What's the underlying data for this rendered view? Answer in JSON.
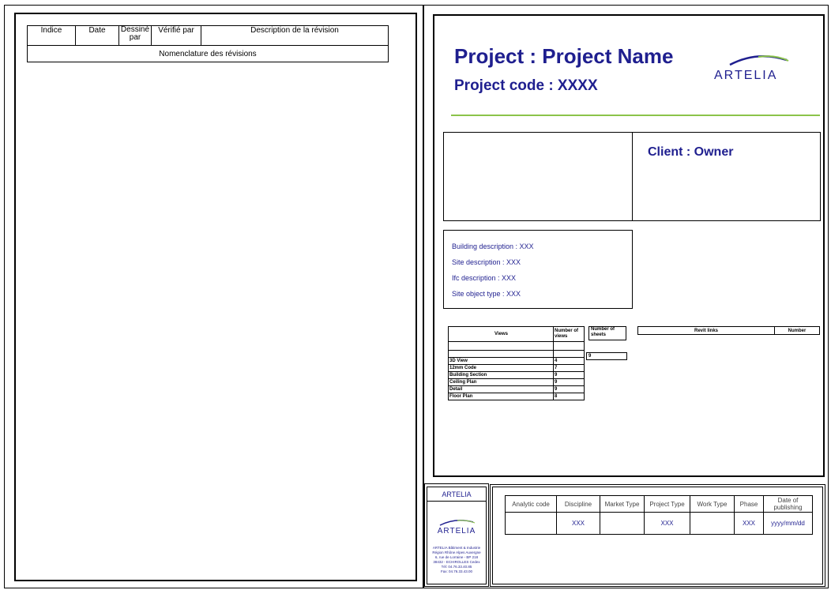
{
  "revision_table": {
    "headers": [
      "Indice",
      "Date",
      "Dessiné par",
      "Vérifié par",
      "Description de la révision"
    ],
    "nomenclature_label": "Nomenclature des révisions"
  },
  "project": {
    "name_line": "Project : Project Name",
    "code_line": "Project code : XXXX",
    "logo_text": "ARTELIA"
  },
  "colors": {
    "title_blue": "#1f1f8f",
    "accent_green": "#8bc34a"
  },
  "client": {
    "label": "Client : Owner"
  },
  "info_lines": [
    "Building description : XXX",
    "Site description : XXX",
    "Ifc description : XXX",
    "Site object type : XXX"
  ],
  "views_table": {
    "headers": [
      "Views",
      "Number of views",
      "Number of sheets"
    ],
    "rows": [
      {
        "name": "3D View",
        "count": "4"
      },
      {
        "name": "12mm Code",
        "count": "7"
      },
      {
        "name": "Building Section",
        "count": "9"
      },
      {
        "name": "Ceiling Plan",
        "count": "9"
      },
      {
        "name": "Detail",
        "count": "9"
      },
      {
        "name": "Floor Plan",
        "count": "8"
      }
    ],
    "sheets_value": "9"
  },
  "link_table": {
    "headers": [
      "Revit links",
      "Number"
    ]
  },
  "company_box": {
    "title": "ARTELIA",
    "logo_text": "ARTELIA",
    "address_lines": [
      "ARTELIA Bâtiment & Industrie",
      "Région Rhône Alpes Auvergne",
      "6, rue de Lorraine - BP 218",
      "38432 - ECHIROLLES Cedex",
      "Tél: 04.76.33.40.85",
      "Fax: 04.76.33.43.00"
    ]
  },
  "bottom_table": {
    "headers": [
      "Analytic code",
      "Discipline",
      "Market Type",
      "Project Type",
      "Work Type",
      "Phase",
      "Date of publishing"
    ],
    "values": [
      "",
      "XXX",
      "",
      "XXX",
      "",
      "XXX",
      "yyyy/mm/dd"
    ]
  }
}
